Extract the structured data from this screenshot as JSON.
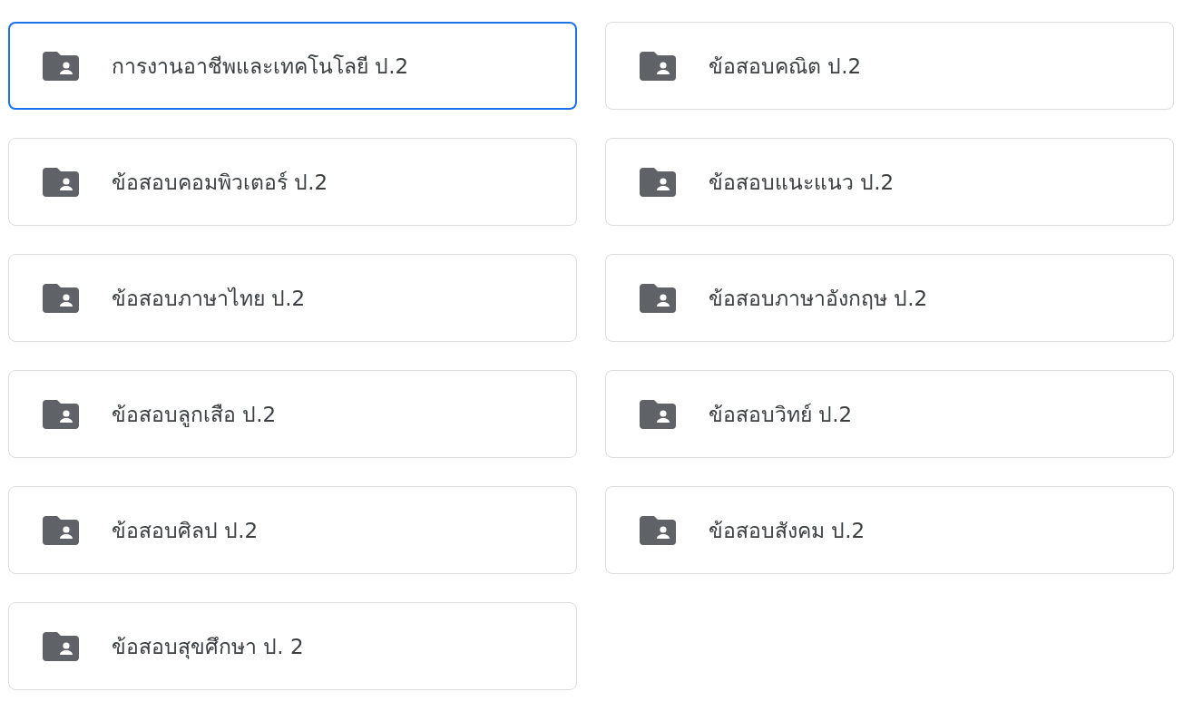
{
  "folders": [
    {
      "name": "การงานอาชีพและเทคโนโลยี ป.2",
      "selected": true
    },
    {
      "name": "ข้อสอบคณิต ป.2",
      "selected": false
    },
    {
      "name": "ข้อสอบคอมพิวเตอร์ ป.2",
      "selected": false
    },
    {
      "name": "ข้อสอบแนะแนว ป.2",
      "selected": false
    },
    {
      "name": "ข้อสอบภาษาไทย ป.2",
      "selected": false
    },
    {
      "name": "ข้อสอบภาษาอังกฤษ ป.2",
      "selected": false
    },
    {
      "name": "ข้อสอบลูกเสือ ป.2",
      "selected": false
    },
    {
      "name": "ข้อสอบวิทย์ ป.2",
      "selected": false
    },
    {
      "name": "ข้อสอบศิลป ป.2",
      "selected": false
    },
    {
      "name": "ข้อสอบสังคม ป.2",
      "selected": false
    },
    {
      "name": "ข้อสอบสุขศึกษา ป. 2",
      "selected": false
    }
  ]
}
